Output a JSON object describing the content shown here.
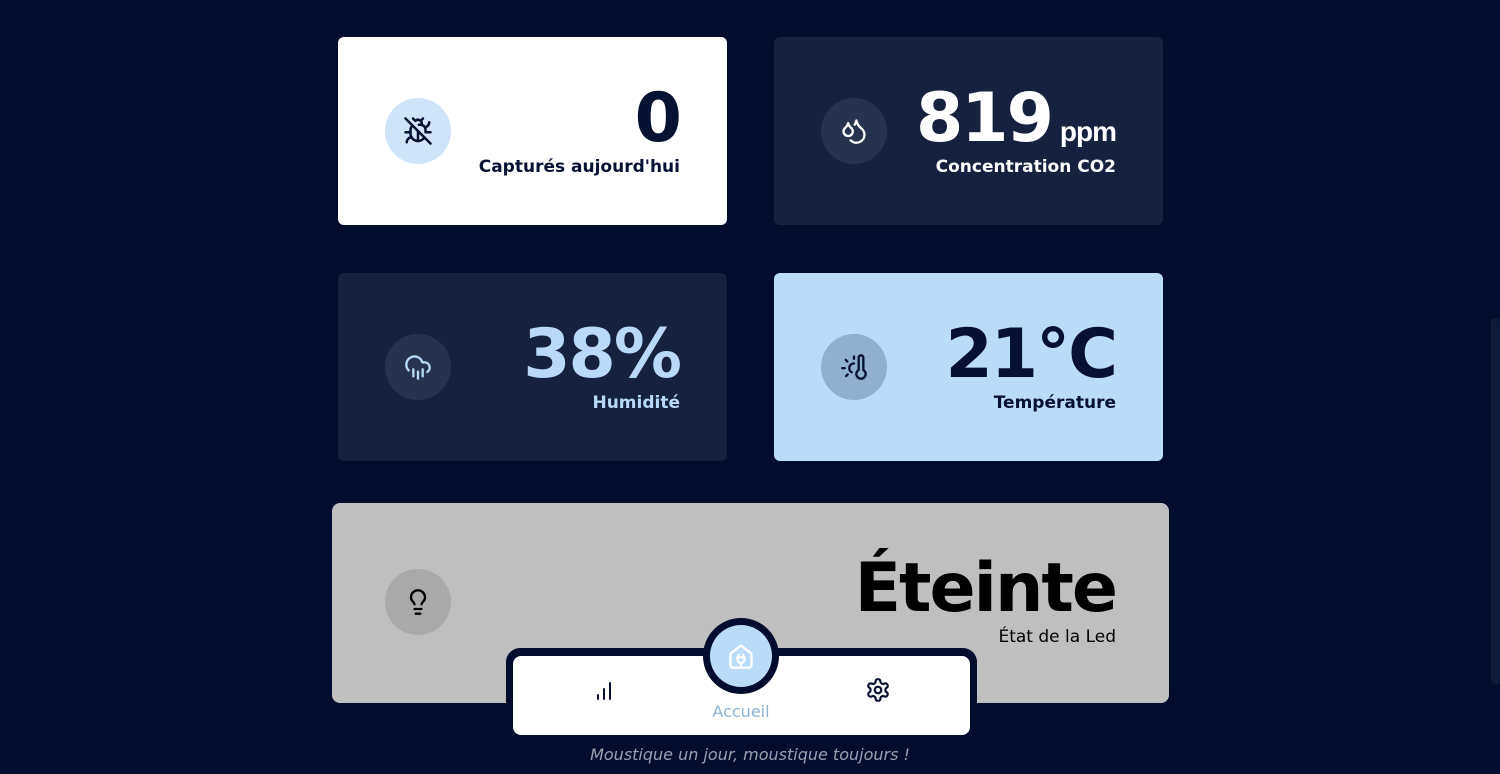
{
  "cards": {
    "captures": {
      "value": "0",
      "label": "Capturés aujourd'hui",
      "icon": "bug-off-icon"
    },
    "co2": {
      "value": "819",
      "unit": "ppm",
      "label": "Concentration CO2",
      "icon": "droplets-icon"
    },
    "humidity": {
      "value": "38%",
      "label": "Humidité",
      "icon": "cloud-rain-icon"
    },
    "temperature": {
      "value": "21°C",
      "label": "Température",
      "icon": "thermometer-sun-icon"
    },
    "led": {
      "value": "Éteinte",
      "label": "État de la Led",
      "icon": "lightbulb-icon"
    }
  },
  "nav": {
    "items": [
      {
        "icon": "bar-chart-icon",
        "label": ""
      },
      {
        "icon": "home-icon",
        "label": "Accueil",
        "active": true
      },
      {
        "icon": "settings-icon",
        "label": ""
      }
    ],
    "active_label": "Accueil"
  },
  "footer": {
    "tagline": "Moustique un jour, moustique toujours !"
  },
  "colors": {
    "background": "#020c2e",
    "card_dark": "#16213f",
    "card_light_blue": "#b9dcfb",
    "card_grey": "#bfbfbf",
    "accent": "#8db2d6"
  }
}
